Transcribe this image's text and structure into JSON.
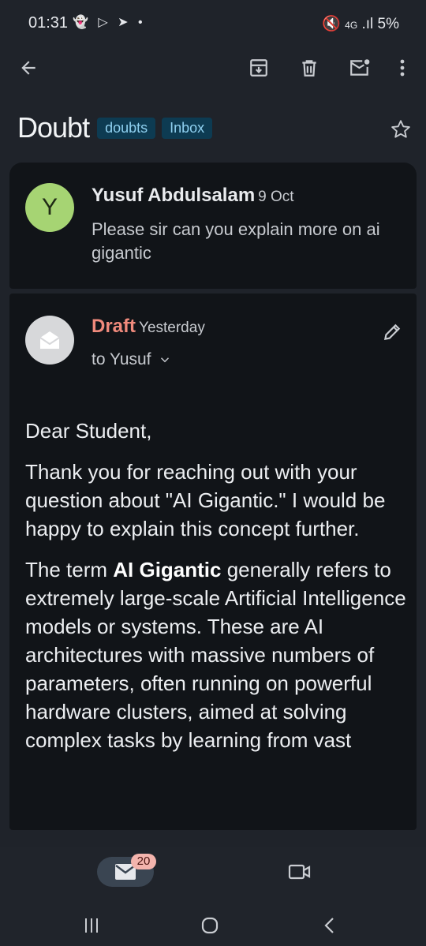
{
  "status_bar": {
    "time": "01:31",
    "notifications": "👻 ▷ ➤ •",
    "network": "4G",
    "battery": "5%"
  },
  "toolbar": {
    "back_icon": "arrow-left-icon",
    "archive_icon": "archive-icon",
    "delete_icon": "trash-icon",
    "mark_unread_icon": "mark-unread-icon",
    "more_icon": "more-vert-icon"
  },
  "thread": {
    "subject": "Doubt",
    "labels": [
      "doubts",
      "Inbox"
    ]
  },
  "message1": {
    "avatar_letter": "Y",
    "sender": "Yusuf Abdulsalam",
    "date": "9 Oct",
    "snippet": "Please sir can you explain more on ai gigantic"
  },
  "message2": {
    "status": "Draft",
    "date": "Yesterday",
    "to": "to Yusuf",
    "body": {
      "greeting": "Dear Student,",
      "p1": "Thank you for reaching out with your question about \"AI Gigantic.\" I would be happy to explain this concept further.",
      "p2_before": "The term ",
      "p2_bold": "AI Gigantic",
      "p2_after": " generally refers to extremely large-scale Artificial Intelligence models or systems. These are AI architectures with massive numbers of parameters, often running on powerful hardware clusters, aimed at solving complex tasks by learning from vast"
    }
  },
  "bottom_nav": {
    "mail_badge": "20"
  },
  "colors": {
    "background": "#1f232a",
    "card": "#111418",
    "label_bg": "#0d3b52",
    "label_text": "#8fd0f0",
    "draft": "#f08a7c",
    "avatar_y": "#a6d473"
  }
}
